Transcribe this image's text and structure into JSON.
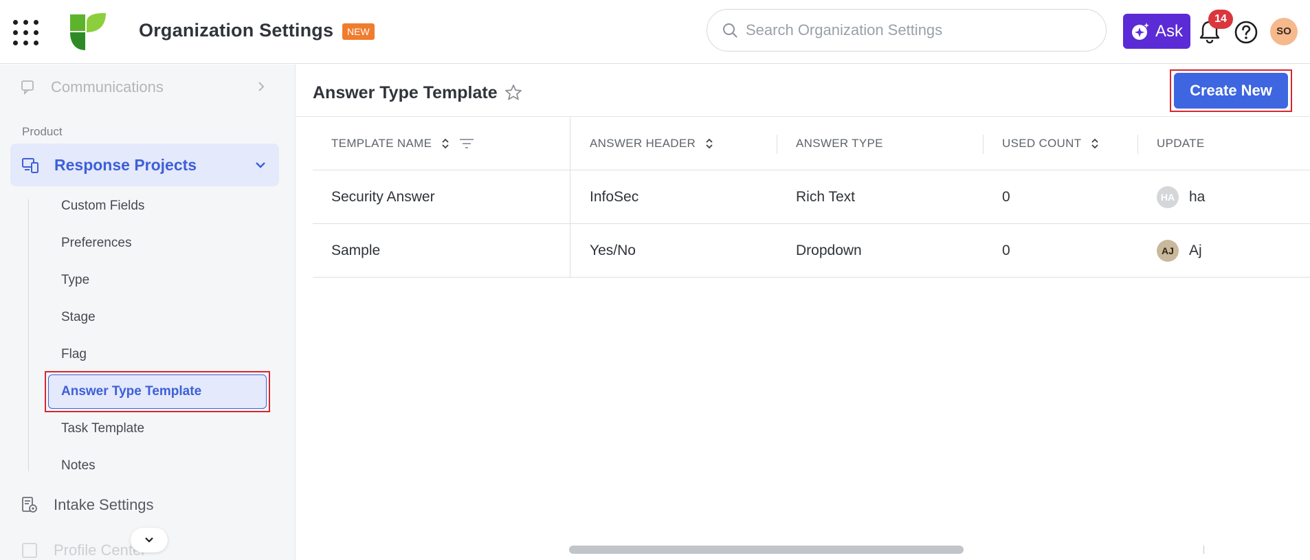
{
  "header": {
    "app_title": "Organization Settings",
    "new_badge": "NEW",
    "search_placeholder": "Search Organization Settings",
    "ask_label": "Ask",
    "notification_count": "14",
    "user_initials": "SO",
    "colors": {
      "ask": "#5b2bd6",
      "badge": "#f07c2e",
      "notification": "#d9363e",
      "avatar": "#f6b88d"
    }
  },
  "sidebar": {
    "communications_label": "Communications",
    "section_label": "Product",
    "response_projects_label": "Response Projects",
    "items": [
      {
        "label": "Custom Fields"
      },
      {
        "label": "Preferences"
      },
      {
        "label": "Type"
      },
      {
        "label": "Stage"
      },
      {
        "label": "Flag"
      },
      {
        "label": "Answer Type Template",
        "active": true
      },
      {
        "label": "Task Template"
      },
      {
        "label": "Notes"
      }
    ],
    "intake_label": "Intake Settings",
    "profile_label": "Profile Center"
  },
  "main": {
    "page_title": "Answer Type Template",
    "create_label": "Create New",
    "columns": [
      "TEMPLATE NAME",
      "ANSWER HEADER",
      "ANSWER TYPE",
      "USED COUNT",
      "UPDATE"
    ],
    "rows": [
      {
        "template_name": "Security Answer",
        "answer_header": "InfoSec",
        "answer_type": "Rich Text",
        "used_count": "0",
        "updated_initials": "HA",
        "updated_name": "ha",
        "avatar_bg": "#d4d6da",
        "avatar_fg": "#ffffff"
      },
      {
        "template_name": "Sample",
        "answer_header": "Yes/No",
        "answer_type": "Dropdown",
        "used_count": "0",
        "updated_initials": "AJ",
        "updated_name": "Aj",
        "avatar_bg": "#c9b89c",
        "avatar_fg": "#2e2416"
      }
    ],
    "accent": "#3d66e0"
  }
}
